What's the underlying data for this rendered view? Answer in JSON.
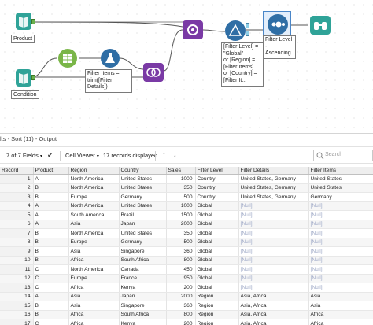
{
  "canvas": {
    "product_label": "Product",
    "condition_label": "Condition",
    "formula_box": [
      "Filter Items =",
      "trim([Filter",
      "Details])"
    ],
    "filter_box": [
      "[Filter Level] =",
      "\"Global\"",
      "or [Region] =",
      "[Filter Items]",
      "or [Country] =",
      "[Filter It..."
    ],
    "sort_box": [
      "Filter Level -",
      "Ascending"
    ]
  },
  "results": {
    "title": "lts - Sort (11) - Output",
    "fields_label": "7 of 7 Fields",
    "viewer_label": "Cell Viewer",
    "records_label": "17 records displayed",
    "search_placeholder": "Search"
  },
  "table": {
    "columns": [
      "Record",
      "Product",
      "Region",
      "Country",
      "Sales",
      "Filter Level",
      "Filter Details",
      "Filter Items"
    ],
    "rows": [
      [
        "1",
        "A",
        "North America",
        "United States",
        "1000",
        "Country",
        "United States, Germany",
        "United States"
      ],
      [
        "2",
        "B",
        "North America",
        "United States",
        "350",
        "Country",
        "United States, Germany",
        "United States"
      ],
      [
        "3",
        "B",
        "Europe",
        "Germany",
        "500",
        "Country",
        "United States, Germany",
        "Germany"
      ],
      [
        "4",
        "A",
        "North America",
        "United States",
        "1000",
        "Global",
        "[Null]",
        "[Null]"
      ],
      [
        "5",
        "A",
        "South America",
        "Brazil",
        "1500",
        "Global",
        "[Null]",
        "[Null]"
      ],
      [
        "6",
        "A",
        "Asia",
        "Japan",
        "2000",
        "Global",
        "[Null]",
        "[Null]"
      ],
      [
        "7",
        "B",
        "North America",
        "United States",
        "350",
        "Global",
        "[Null]",
        "[Null]"
      ],
      [
        "8",
        "B",
        "Europe",
        "Germany",
        "500",
        "Global",
        "[Null]",
        "[Null]"
      ],
      [
        "9",
        "B",
        "Asia",
        "Singapore",
        "360",
        "Global",
        "[Null]",
        "[Null]"
      ],
      [
        "10",
        "B",
        "Africa",
        "South Africa",
        "800",
        "Global",
        "[Null]",
        "[Null]"
      ],
      [
        "11",
        "C",
        "North America",
        "Canada",
        "450",
        "Global",
        "[Null]",
        "[Null]"
      ],
      [
        "12",
        "C",
        "Europe",
        "France",
        "950",
        "Global",
        "[Null]",
        "[Null]"
      ],
      [
        "13",
        "C",
        "Africa",
        "Kenya",
        "200",
        "Global",
        "[Null]",
        "[Null]"
      ],
      [
        "14",
        "A",
        "Asia",
        "Japan",
        "2000",
        "Region",
        "Asia, Africa",
        "Asia"
      ],
      [
        "15",
        "B",
        "Asia",
        "Singapore",
        "360",
        "Region",
        "Asia, Africa",
        "Asia"
      ],
      [
        "16",
        "B",
        "Africa",
        "South Africa",
        "800",
        "Region",
        "Asia, Africa",
        "Africa"
      ],
      [
        "17",
        "C",
        "Africa",
        "Kenya",
        "200",
        "Region",
        "Asia, Africa",
        "Africa"
      ]
    ]
  },
  "colors": {
    "input_tool": "#2fa398",
    "formula_tool": "#7ab648",
    "filter_tool": "#2f6ea5",
    "join_tool": "#7a3aa5",
    "sort_tool": "#2f6ea5",
    "browse_tool": "#2fa398",
    "null_text": "#9aa5c4"
  }
}
